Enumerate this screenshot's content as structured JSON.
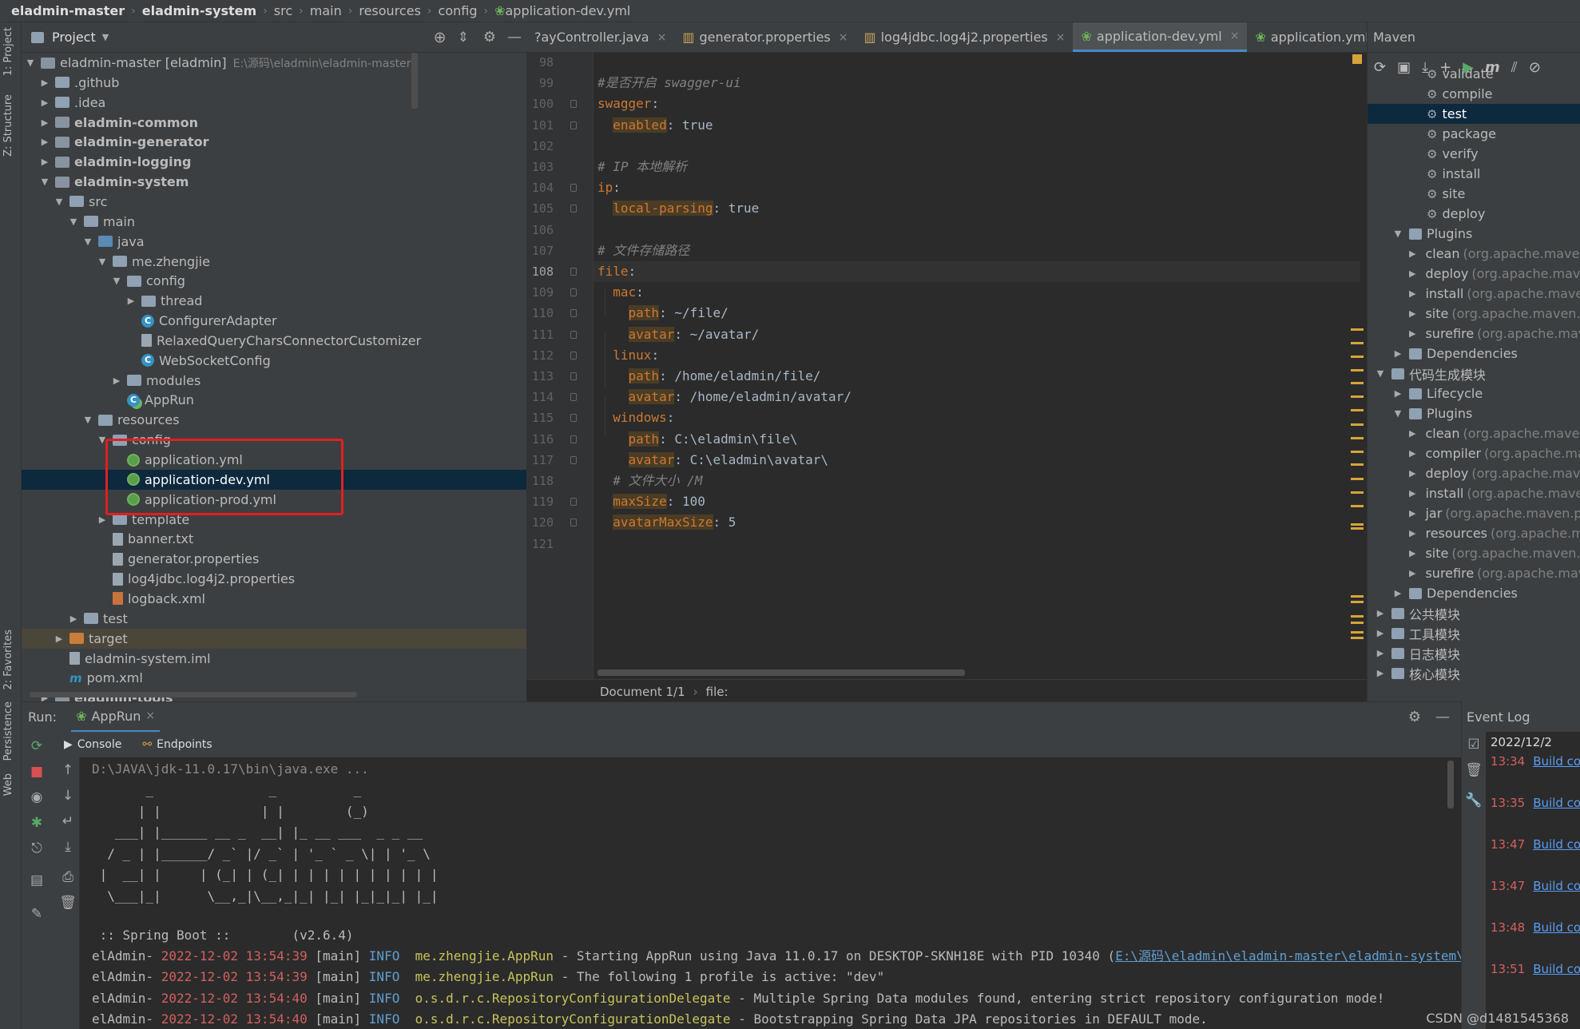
{
  "breadcrumb": [
    "eladmin-master",
    "eladmin-system",
    "src",
    "main",
    "resources",
    "config",
    "application-dev.yml"
  ],
  "left_strip": {
    "project": "1: Project",
    "structure": "Z: Structure",
    "favorites": "2: Favorites",
    "persistence": "Persistence",
    "web": "Web"
  },
  "project_panel": {
    "title": "Project",
    "tree": [
      {
        "indent": 0,
        "arrow": "▼",
        "icon": "module",
        "label": "eladmin-master [eladmin]",
        "path": "E:\\源码\\eladmin\\eladmin-master",
        "bold": false
      },
      {
        "indent": 1,
        "arrow": "▶",
        "icon": "folder",
        "label": ".github"
      },
      {
        "indent": 1,
        "arrow": "▶",
        "icon": "folder",
        "label": ".idea"
      },
      {
        "indent": 1,
        "arrow": "▶",
        "icon": "module",
        "label": "eladmin-common",
        "bold": true
      },
      {
        "indent": 1,
        "arrow": "▶",
        "icon": "module",
        "label": "eladmin-generator",
        "bold": true
      },
      {
        "indent": 1,
        "arrow": "▶",
        "icon": "module",
        "label": "eladmin-logging",
        "bold": true
      },
      {
        "indent": 1,
        "arrow": "▼",
        "icon": "module",
        "label": "eladmin-system",
        "bold": true
      },
      {
        "indent": 2,
        "arrow": "▼",
        "icon": "folder",
        "label": "src"
      },
      {
        "indent": 3,
        "arrow": "▼",
        "icon": "folder",
        "label": "main"
      },
      {
        "indent": 4,
        "arrow": "▼",
        "icon": "folder-blue",
        "label": "java"
      },
      {
        "indent": 5,
        "arrow": "▼",
        "icon": "folder",
        "label": "me.zhengjie"
      },
      {
        "indent": 6,
        "arrow": "▼",
        "icon": "folder",
        "label": "config"
      },
      {
        "indent": 7,
        "arrow": "▶",
        "icon": "folder",
        "label": "thread"
      },
      {
        "indent": 7,
        "arrow": "",
        "icon": "class",
        "label": "ConfigurerAdapter"
      },
      {
        "indent": 7,
        "arrow": "",
        "icon": "file",
        "label": "RelaxedQueryCharsConnectorCustomizer"
      },
      {
        "indent": 7,
        "arrow": "",
        "icon": "class",
        "label": "WebSocketConfig"
      },
      {
        "indent": 6,
        "arrow": "▶",
        "icon": "folder",
        "label": "modules"
      },
      {
        "indent": 6,
        "arrow": "",
        "icon": "spring",
        "label": "AppRun"
      },
      {
        "indent": 4,
        "arrow": "▼",
        "icon": "folder",
        "label": "resources"
      },
      {
        "indent": 5,
        "arrow": "▼",
        "icon": "folder",
        "label": "config"
      },
      {
        "indent": 6,
        "arrow": "",
        "icon": "yml",
        "label": "application.yml"
      },
      {
        "indent": 6,
        "arrow": "",
        "icon": "yml",
        "label": "application-dev.yml",
        "selected": true
      },
      {
        "indent": 6,
        "arrow": "",
        "icon": "yml",
        "label": "application-prod.yml"
      },
      {
        "indent": 5,
        "arrow": "▶",
        "icon": "folder",
        "label": "template"
      },
      {
        "indent": 5,
        "arrow": "",
        "icon": "file",
        "label": "banner.txt"
      },
      {
        "indent": 5,
        "arrow": "",
        "icon": "file",
        "label": "generator.properties"
      },
      {
        "indent": 5,
        "arrow": "",
        "icon": "file",
        "label": "log4jdbc.log4j2.properties"
      },
      {
        "indent": 5,
        "arrow": "",
        "icon": "file-orange",
        "label": "logback.xml"
      },
      {
        "indent": 3,
        "arrow": "▶",
        "icon": "folder",
        "label": "test"
      },
      {
        "indent": 2,
        "arrow": "▶",
        "icon": "folder-orange",
        "label": "target",
        "target": true
      },
      {
        "indent": 2,
        "arrow": "",
        "icon": "file",
        "label": "eladmin-system.iml"
      },
      {
        "indent": 2,
        "arrow": "",
        "icon": "maven",
        "label": "pom.xml"
      },
      {
        "indent": 1,
        "arrow": "▶",
        "icon": "module",
        "label": "eladmin-tools",
        "bold": true
      }
    ]
  },
  "editor": {
    "tabs": [
      {
        "label": "PayController.java",
        "shown": "?ayController.java"
      },
      {
        "label": "generator.properties"
      },
      {
        "label": "log4jdbc.log4j2.properties"
      },
      {
        "label": "application-dev.yml",
        "active": true
      },
      {
        "label": "application.yml"
      }
    ],
    "current_line": 108,
    "lines": [
      {
        "n": 98,
        "parts": []
      },
      {
        "n": 99,
        "parts": [
          {
            "t": "#是否开启 swagger-ui",
            "c": "cm"
          }
        ]
      },
      {
        "n": 100,
        "parts": [
          {
            "t": "swagger",
            "c": "kw"
          },
          {
            "t": ":",
            "c": "val"
          }
        ]
      },
      {
        "n": 101,
        "parts": [
          {
            "t": "  ",
            "c": "val"
          },
          {
            "t": "enabled",
            "c": "kh"
          },
          {
            "t": ": true",
            "c": "val"
          }
        ]
      },
      {
        "n": 102,
        "parts": []
      },
      {
        "n": 103,
        "parts": [
          {
            "t": "# IP 本地解析",
            "c": "cm"
          }
        ]
      },
      {
        "n": 104,
        "parts": [
          {
            "t": "ip",
            "c": "kw"
          },
          {
            "t": ":",
            "c": "val"
          }
        ]
      },
      {
        "n": 105,
        "parts": [
          {
            "t": "  ",
            "c": "val"
          },
          {
            "t": "local-parsing",
            "c": "kh"
          },
          {
            "t": ": true",
            "c": "val"
          }
        ]
      },
      {
        "n": 106,
        "parts": []
      },
      {
        "n": 107,
        "parts": [
          {
            "t": "# 文件存储路径",
            "c": "cm"
          }
        ]
      },
      {
        "n": 108,
        "parts": [
          {
            "t": "file",
            "c": "kw"
          },
          {
            "t": ":",
            "c": "val"
          }
        ]
      },
      {
        "n": 109,
        "parts": [
          {
            "t": "  mac",
            "c": "kw"
          },
          {
            "t": ":",
            "c": "val"
          }
        ]
      },
      {
        "n": 110,
        "parts": [
          {
            "t": "    ",
            "c": "val"
          },
          {
            "t": "path",
            "c": "kh"
          },
          {
            "t": ": ~/file/",
            "c": "val"
          }
        ]
      },
      {
        "n": 111,
        "parts": [
          {
            "t": "    ",
            "c": "val"
          },
          {
            "t": "avatar",
            "c": "kh"
          },
          {
            "t": ": ~/avatar/",
            "c": "val"
          }
        ]
      },
      {
        "n": 112,
        "parts": [
          {
            "t": "  linux",
            "c": "kw"
          },
          {
            "t": ":",
            "c": "val"
          }
        ]
      },
      {
        "n": 113,
        "parts": [
          {
            "t": "    ",
            "c": "val"
          },
          {
            "t": "path",
            "c": "kh"
          },
          {
            "t": ": /home/eladmin/file/",
            "c": "val"
          }
        ]
      },
      {
        "n": 114,
        "parts": [
          {
            "t": "    ",
            "c": "val"
          },
          {
            "t": "avatar",
            "c": "kh"
          },
          {
            "t": ": /home/eladmin/avatar/",
            "c": "val"
          }
        ]
      },
      {
        "n": 115,
        "parts": [
          {
            "t": "  windows",
            "c": "kw"
          },
          {
            "t": ":",
            "c": "val"
          }
        ]
      },
      {
        "n": 116,
        "parts": [
          {
            "t": "    ",
            "c": "val"
          },
          {
            "t": "path",
            "c": "kh"
          },
          {
            "t": ": C:\\eladmin\\file\\",
            "c": "val"
          }
        ]
      },
      {
        "n": 117,
        "parts": [
          {
            "t": "    ",
            "c": "val"
          },
          {
            "t": "avatar",
            "c": "kh"
          },
          {
            "t": ": C:\\eladmin\\avatar\\",
            "c": "val"
          }
        ]
      },
      {
        "n": 118,
        "parts": [
          {
            "t": "  # 文件大小 /M",
            "c": "cm"
          }
        ]
      },
      {
        "n": 119,
        "parts": [
          {
            "t": "  ",
            "c": "val"
          },
          {
            "t": "maxSize",
            "c": "kh"
          },
          {
            "t": ": 100",
            "c": "val"
          }
        ]
      },
      {
        "n": 120,
        "parts": [
          {
            "t": "  ",
            "c": "val"
          },
          {
            "t": "avatarMaxSize",
            "c": "kh"
          },
          {
            "t": ": 5",
            "c": "val"
          }
        ]
      },
      {
        "n": 121,
        "parts": []
      }
    ],
    "status": {
      "doc": "Document 1/1",
      "path": "file:"
    }
  },
  "maven": {
    "title": "Maven",
    "items": [
      {
        "indent": 3,
        "icon": "gear",
        "label": "validate"
      },
      {
        "indent": 3,
        "icon": "gear",
        "label": "compile"
      },
      {
        "indent": 3,
        "icon": "gear",
        "label": "test",
        "selected": true
      },
      {
        "indent": 3,
        "icon": "gear",
        "label": "package"
      },
      {
        "indent": 3,
        "icon": "gear",
        "label": "verify"
      },
      {
        "indent": 3,
        "icon": "gear",
        "label": "install"
      },
      {
        "indent": 3,
        "icon": "gear",
        "label": "site"
      },
      {
        "indent": 3,
        "icon": "gear",
        "label": "deploy"
      },
      {
        "indent": 2,
        "arrow": "▼",
        "icon": "folder",
        "label": "Plugins"
      },
      {
        "indent": 3,
        "arrow": "▶",
        "icon": "plugin",
        "label": "clean",
        "grey": "(org.apache.maven.plugins)"
      },
      {
        "indent": 3,
        "arrow": "▶",
        "icon": "plugin",
        "label": "deploy",
        "grey": "(org.apache.maven.plugins)"
      },
      {
        "indent": 3,
        "arrow": "▶",
        "icon": "plugin",
        "label": "install",
        "grey": "(org.apache.maven.plugins)"
      },
      {
        "indent": 3,
        "arrow": "▶",
        "icon": "plugin",
        "label": "site",
        "grey": "(org.apache.maven.plugins)"
      },
      {
        "indent": 3,
        "arrow": "▶",
        "icon": "plugin",
        "label": "surefire",
        "grey": "(org.apache.maven.plugins)"
      },
      {
        "indent": 2,
        "arrow": "▶",
        "icon": "folder",
        "label": "Dependencies"
      },
      {
        "indent": 1,
        "arrow": "▼",
        "icon": "module",
        "label": "代码生成模块"
      },
      {
        "indent": 2,
        "arrow": "▶",
        "icon": "folder",
        "label": "Lifecycle"
      },
      {
        "indent": 2,
        "arrow": "▼",
        "icon": "folder",
        "label": "Plugins"
      },
      {
        "indent": 3,
        "arrow": "▶",
        "icon": "plugin",
        "label": "clean",
        "grey": "(org.apache.maven.plugins)"
      },
      {
        "indent": 3,
        "arrow": "▶",
        "icon": "plugin",
        "label": "compiler",
        "grey": "(org.apache.maven.plugins)"
      },
      {
        "indent": 3,
        "arrow": "▶",
        "icon": "plugin",
        "label": "deploy",
        "grey": "(org.apache.maven.plugins)"
      },
      {
        "indent": 3,
        "arrow": "▶",
        "icon": "plugin",
        "label": "install",
        "grey": "(org.apache.maven.plugins)"
      },
      {
        "indent": 3,
        "arrow": "▶",
        "icon": "plugin",
        "label": "jar",
        "grey": "(org.apache.maven.plugins)"
      },
      {
        "indent": 3,
        "arrow": "▶",
        "icon": "plugin",
        "label": "resources",
        "grey": "(org.apache.maven.plugins)"
      },
      {
        "indent": 3,
        "arrow": "▶",
        "icon": "plugin",
        "label": "site",
        "grey": "(org.apache.maven.plugins)"
      },
      {
        "indent": 3,
        "arrow": "▶",
        "icon": "plugin",
        "label": "surefire",
        "grey": "(org.apache.maven.plugins)"
      },
      {
        "indent": 2,
        "arrow": "▶",
        "icon": "folder",
        "label": "Dependencies"
      },
      {
        "indent": 1,
        "arrow": "▶",
        "icon": "module",
        "label": "公共模块"
      },
      {
        "indent": 1,
        "arrow": "▶",
        "icon": "module",
        "label": "工具模块"
      },
      {
        "indent": 1,
        "arrow": "▶",
        "icon": "module",
        "label": "日志模块"
      },
      {
        "indent": 1,
        "arrow": "▶",
        "icon": "module",
        "label": "核心模块"
      }
    ]
  },
  "run": {
    "label": "Run:",
    "config": "AppRun",
    "subtabs": [
      "Console",
      "Endpoints"
    ],
    "cmd": "D:\\JAVA\\jdk-11.0.17\\bin\\java.exe ...",
    "banner": [
      "       _               _          _",
      "      | |             | |        (_)",
      "   ___| |______ __ _  __| |_ __ ___  _ _ __",
      "  / _ | |______/ _` |/ _` | '_ ` _ \\| | '_ \\",
      " |  __| |     | (_| | (_| | | | | | | | | | |",
      "  \\___|_|      \\__,_|\\__,_|_| |_| |_|_|_| |_|"
    ],
    "spring": " :: Spring Boot ::        (v2.6.4)",
    "logs": [
      {
        "prefix": "elAdmin- ",
        "ts": "2022-12-02 13:54:39",
        "thread": " [main] ",
        "lvl": "INFO",
        "logger": "  me.zhengjie.AppRun",
        "msg": " - Starting AppRun using Java 11.0.17 on DESKTOP-SKNH18E with PID 10340 (",
        "link": "E:\\源码\\eladmin\\eladmin-master\\eladmin-system\\target\\classes"
      },
      {
        "prefix": "elAdmin- ",
        "ts": "2022-12-02 13:54:39",
        "thread": " [main] ",
        "lvl": "INFO",
        "logger": "  me.zhengjie.AppRun",
        "msg": " - The following 1 profile is active: \"dev\"",
        "link": ""
      },
      {
        "prefix": "elAdmin- ",
        "ts": "2022-12-02 13:54:40",
        "thread": " [main] ",
        "lvl": "INFO",
        "logger": "  o.s.d.r.c.RepositoryConfigurationDelegate",
        "msg": " - Multiple Spring Data modules found, entering strict repository configuration mode!",
        "link": ""
      },
      {
        "prefix": "elAdmin- ",
        "ts": "2022-12-02 13:54:40",
        "thread": " [main] ",
        "lvl": "INFO",
        "logger": "  o.s.d.r.c.RepositoryConfigurationDelegate",
        "msg": " - Bootstrapping Spring Data JPA repositories in DEFAULT mode.",
        "link": ""
      }
    ]
  },
  "event_log": {
    "title": "Event Log",
    "date": "2022/12/2",
    "events": [
      {
        "time": "13:34",
        "text": "Build completed"
      },
      {
        "time": "13:35",
        "text": "Build completed"
      },
      {
        "time": "13:47",
        "text": "Build completed"
      },
      {
        "time": "13:47",
        "text": "Build completed"
      },
      {
        "time": "13:48",
        "text": "Build completed"
      },
      {
        "time": "13:51",
        "text": "Build completed"
      }
    ]
  },
  "watermark": "CSDN @d1481545368",
  "colors": {
    "highlight_box": "#e02020",
    "selection": "#0d293e",
    "keyword": "#cc7832",
    "comment": "#808080"
  }
}
